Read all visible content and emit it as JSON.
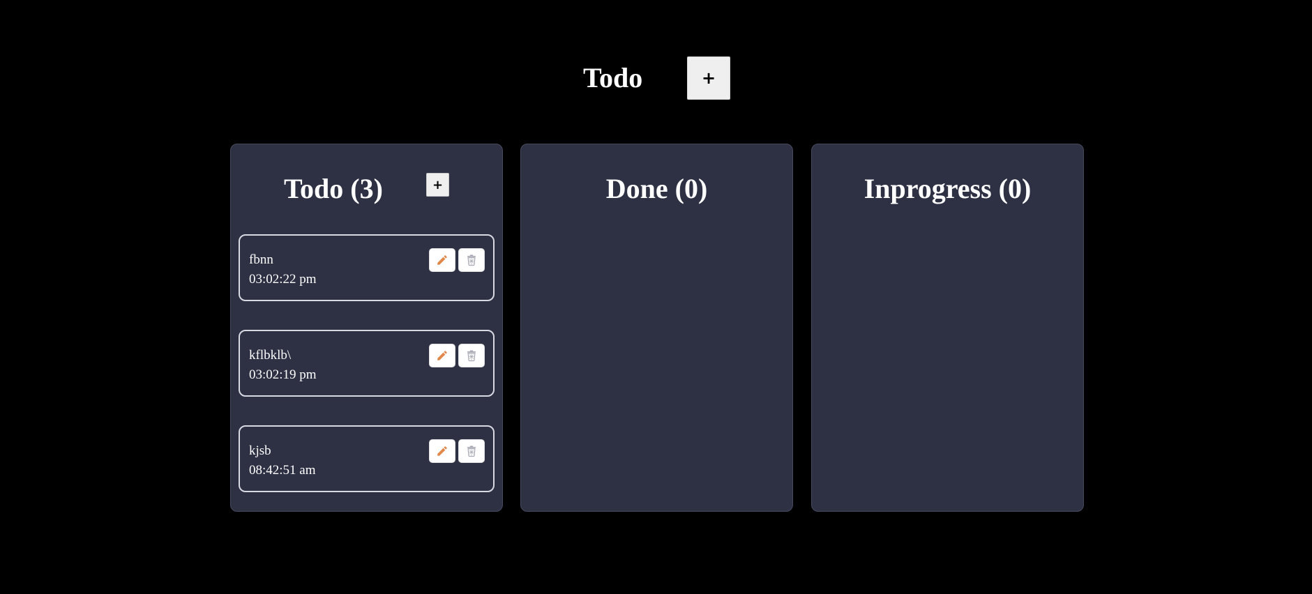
{
  "header": {
    "title": "Todo",
    "add_label": "+"
  },
  "columns": [
    {
      "title": "Todo (3)",
      "add_label": "+",
      "tasks": [
        {
          "name": "fbnn",
          "time": "03:02:22 pm"
        },
        {
          "name": "kflbklb\\",
          "time": "03:02:19 pm"
        },
        {
          "name": "kjsb",
          "time": "08:42:51 am"
        }
      ]
    },
    {
      "title": "Done (0)",
      "tasks": []
    },
    {
      "title": "Inprogress (0)",
      "tasks": []
    }
  ],
  "icons": {
    "edit": "pencil-icon",
    "delete": "trash-icon"
  },
  "colors": {
    "background": "#000000",
    "column_bg": "#2e3043",
    "edit_icon": "#e0884a",
    "delete_icon": "#a8a8b4",
    "text": "#ffffff"
  }
}
